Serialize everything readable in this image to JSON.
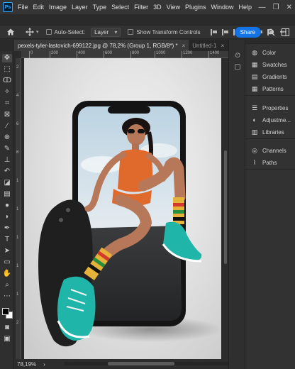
{
  "menubar": {
    "logo": "Ps",
    "items": [
      "File",
      "Edit",
      "Image",
      "Layer",
      "Type",
      "Select",
      "Filter",
      "3D",
      "View",
      "Plugins",
      "Window",
      "Help"
    ],
    "window_controls": [
      "—",
      "❐",
      "✕"
    ]
  },
  "optionsbar": {
    "home_icon": "home-icon",
    "move_icon": "move-icon",
    "auto_select_label": "Auto-Select:",
    "auto_select_target": "Layer",
    "show_transform_label": "Show Transform Controls",
    "share_label": "Share",
    "search_icon": "search-icon",
    "workspace_icon": "workspace-icon"
  },
  "tabs": [
    {
      "label": "pexels-tyler-lastovich-699122.jpg @ 78,2% (Group 1, RGB/8*) *",
      "close": "×",
      "active": true
    },
    {
      "label": "Untitled-1",
      "close": "×",
      "active": false
    }
  ],
  "ruler": {
    "h_ticks": [
      "0",
      "200",
      "400",
      "600",
      "800",
      "1000",
      "1200",
      "1400"
    ],
    "v_ticks": [
      "2",
      "4",
      "6",
      "8",
      "1",
      "1",
      "1",
      "1",
      "1",
      "2"
    ]
  },
  "statusbar": {
    "zoom": "78,19%",
    "nav_arrow": "›"
  },
  "panels": {
    "group1": [
      {
        "label": "Color",
        "icon": "color-icon"
      },
      {
        "label": "Swatches",
        "icon": "swatches-icon"
      },
      {
        "label": "Gradients",
        "icon": "gradients-icon"
      },
      {
        "label": "Patterns",
        "icon": "patterns-icon"
      }
    ],
    "group2": [
      {
        "label": "Properties",
        "icon": "properties-icon"
      },
      {
        "label": "Adjustme...",
        "icon": "adjustments-icon"
      },
      {
        "label": "Libraries",
        "icon": "libraries-icon"
      }
    ],
    "group3": [
      {
        "label": "Channels",
        "icon": "channels-icon"
      },
      {
        "label": "Paths",
        "icon": "paths-icon"
      }
    ]
  },
  "colors": {
    "accent": "#1473e6",
    "foreground_swatch": "#000000",
    "background_swatch": "#ffffff",
    "sock_teal": "#1fb5a8",
    "top_orange": "#e06a2c"
  }
}
